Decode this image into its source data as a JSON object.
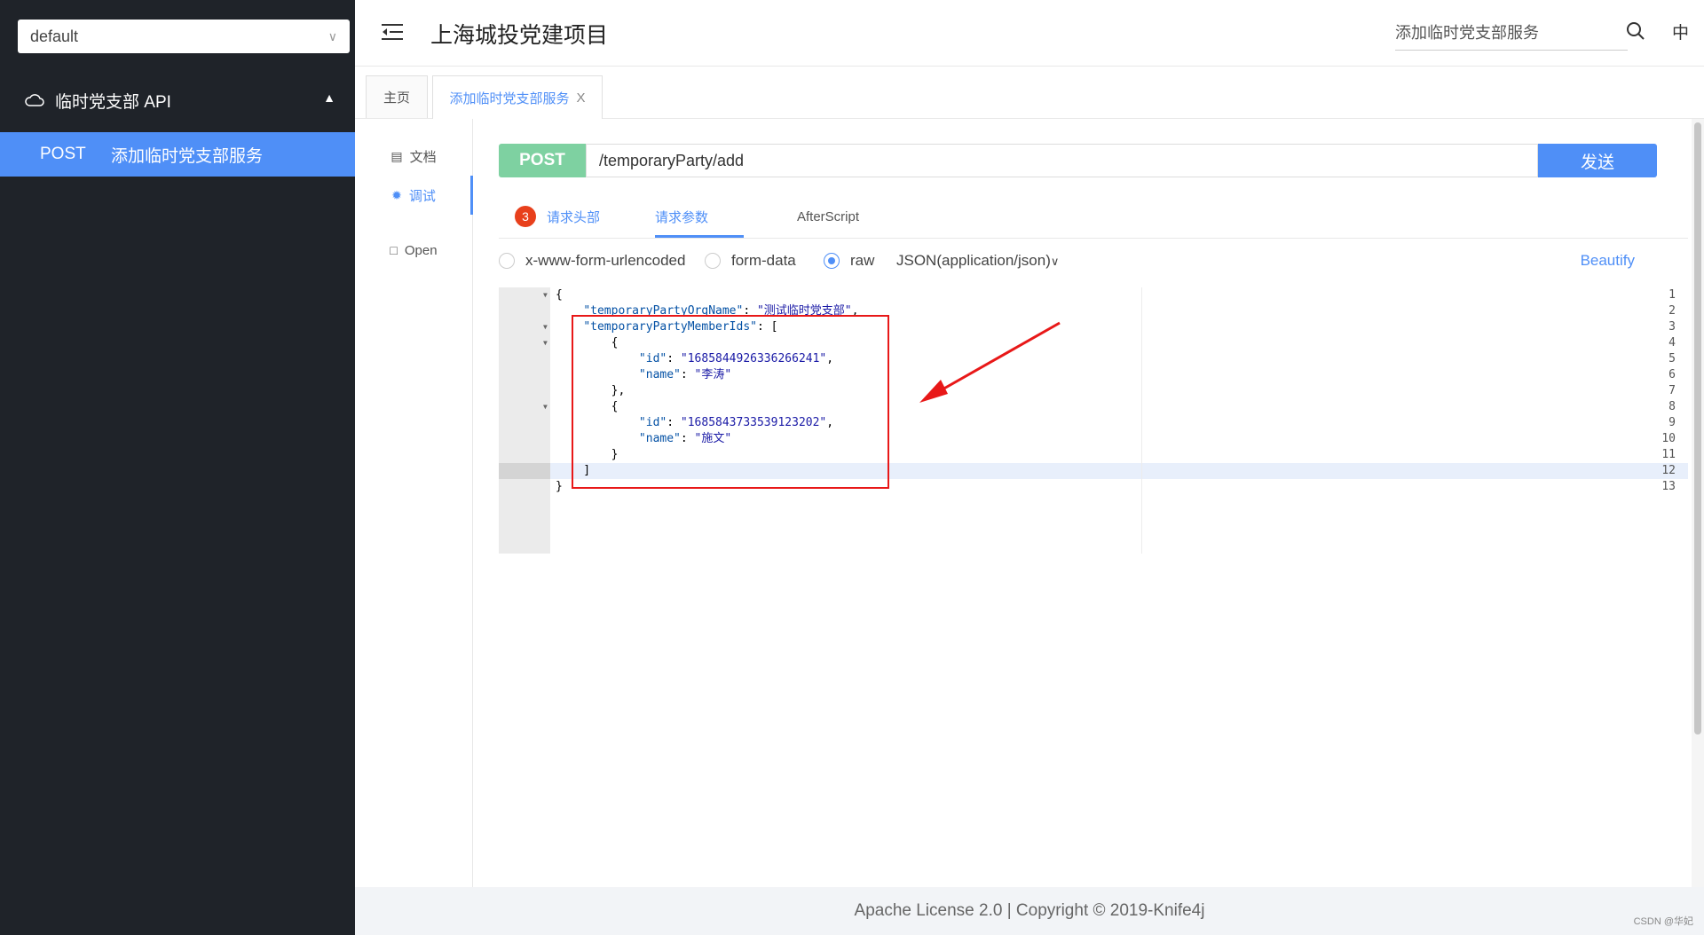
{
  "sidebar": {
    "group_select": "default",
    "api_group": "临时党支部 API",
    "api_item": {
      "method": "POST",
      "label": "添加临时党支部服务"
    }
  },
  "header": {
    "title": "上海城投党建项目",
    "search_text": "添加临时党支部服务",
    "lang": "中"
  },
  "tabs": {
    "home": "主页",
    "active": "添加临时党支部服务",
    "close": "X"
  },
  "docnav": {
    "doc": "文档",
    "debug": "调试",
    "open": "Open"
  },
  "request": {
    "method": "POST",
    "url": "/temporaryParty/add",
    "send": "发送",
    "tabs": {
      "headers_count": "3",
      "headers": "请求头部",
      "params": "请求参数",
      "after": "AfterScript"
    },
    "body_types": [
      "x-www-form-urlencoded",
      "form-data",
      "raw"
    ],
    "selected_body_type": "raw",
    "content_type": "JSON(application/json)",
    "beautify": "Beautify"
  },
  "editor": {
    "line_numbers": [
      "1",
      "2",
      "3",
      "4",
      "5",
      "6",
      "7",
      "8",
      "9",
      "10",
      "11",
      "12",
      "13"
    ],
    "lines": [
      "{",
      "    \"temporaryPartyOrgName\": \"测试临时党支部\",",
      "    \"temporaryPartyMemberIds\": [",
      "        {",
      "            \"id\": \"1685844926336266241\",",
      "            \"name\": \"李涛\"",
      "        },",
      "        {",
      "            \"id\": \"1685843733539123202\",",
      "            \"name\": \"施文\"",
      "        }",
      "    ]",
      "}"
    ],
    "active_line": 12
  },
  "footer": {
    "text": "Apache License 2.0 | Copyright ©  2019-Knife4j",
    "watermark": "CSDN @华妃"
  },
  "colors": {
    "accent": "#4f8ff7",
    "sidebar": "#1f2329",
    "post": "#7ed1a1",
    "annotation": "#e81818",
    "badge": "#e8401c"
  }
}
